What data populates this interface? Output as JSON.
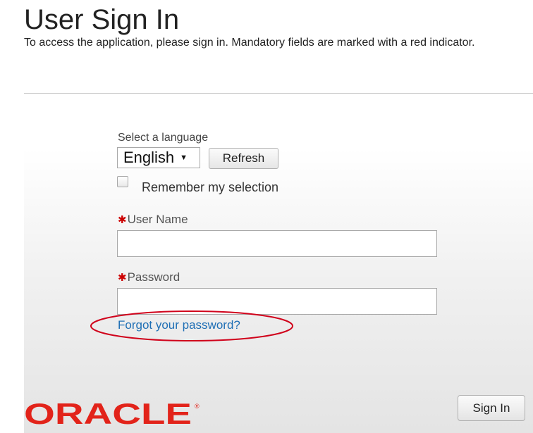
{
  "header": {
    "title": "User Sign In",
    "subtitle": "To access the application, please sign in. Mandatory fields are marked with a red indicator."
  },
  "language": {
    "label": "Select a language",
    "selected": "English",
    "refresh_label": "Refresh",
    "remember_label": "Remember my selection",
    "remember_checked": false
  },
  "form": {
    "required_marker": "✱",
    "username_label": "User Name",
    "username_value": "",
    "password_label": "Password",
    "password_value": "",
    "forgot_link": "Forgot your password?",
    "signin_label": "Sign In"
  },
  "branding": {
    "logo_text": "ORACLE",
    "logo_mark": "®",
    "logo_color": "#e2231a"
  },
  "colors": {
    "accent_link": "#1f6fb5",
    "required": "#cc0000",
    "annotation": "#d0021b"
  },
  "icons": {
    "dropdown": "caret-down-icon",
    "required": "asterisk-icon"
  }
}
